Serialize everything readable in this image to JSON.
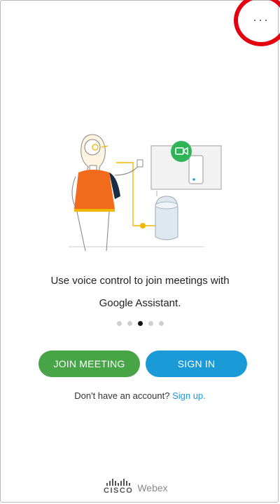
{
  "menu": {
    "more_label": "···"
  },
  "onboarding": {
    "tagline_line1": "Use voice control to join meetings with",
    "tagline_line2": "Google Assistant.",
    "pager_total": 5,
    "pager_active": 3
  },
  "actions": {
    "join_label": "JOIN MEETING",
    "signin_label": "SIGN IN"
  },
  "signup": {
    "prompt": "Don't have an account?",
    "link_label": "Sign up."
  },
  "footer": {
    "cisco_label": "CISCO",
    "webex_label": "Webex"
  },
  "colors": {
    "join": "#47a447",
    "signin": "#1a9ad6",
    "highlight": "#e3000f"
  }
}
